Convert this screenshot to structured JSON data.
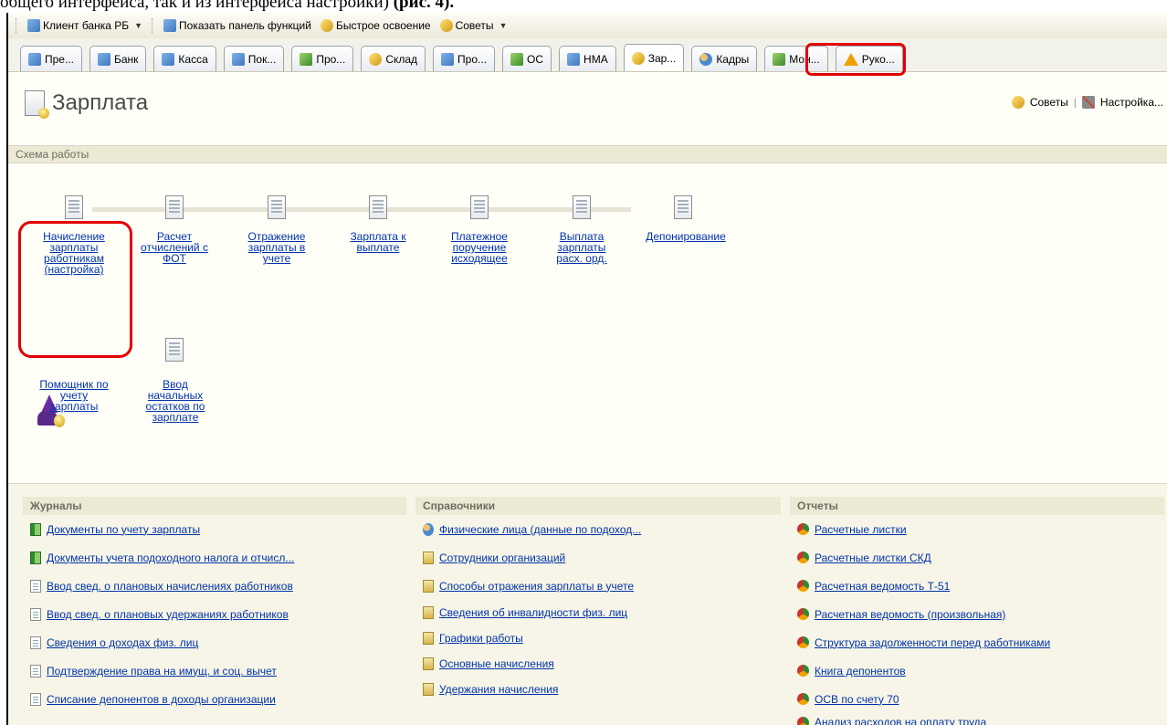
{
  "caption": {
    "text": "общего интерфейса, так и из интерфейса настройки)",
    "bold": "(рис. 4)."
  },
  "toolbar": {
    "items": [
      {
        "label": "Клиент банка РБ",
        "icon": "bank-client-icon",
        "dropdown": true
      },
      {
        "label": "Показать панель функций",
        "icon": "function-panel-icon",
        "dropdown": false
      },
      {
        "label": "Быстрое освоение",
        "icon": "quick-start-icon",
        "dropdown": false
      },
      {
        "label": "Советы",
        "icon": "tips-icon",
        "dropdown": true
      }
    ]
  },
  "tabs": [
    {
      "label": "Пре...",
      "icon": "enterprise-icon",
      "active": false
    },
    {
      "label": "Банк",
      "icon": "bank-icon",
      "active": false
    },
    {
      "label": "Касса",
      "icon": "cash-icon",
      "active": false
    },
    {
      "label": "Пок...",
      "icon": "purchase-icon",
      "active": false
    },
    {
      "label": "Про...",
      "icon": "production-icon",
      "active": false
    },
    {
      "label": "Склад",
      "icon": "warehouse-icon",
      "active": false
    },
    {
      "label": "Про...",
      "icon": "sales-icon",
      "active": false
    },
    {
      "label": "ОС",
      "icon": "fixed-assets-icon",
      "active": false
    },
    {
      "label": "НМА",
      "icon": "intangible-assets-icon",
      "active": false
    },
    {
      "label": "Зар...",
      "icon": "salary-icon",
      "active": true
    },
    {
      "label": "Кадры",
      "icon": "staff-icon",
      "active": false
    },
    {
      "label": "Мон...",
      "icon": "monitor-icon",
      "active": false
    },
    {
      "label": "Руко...",
      "icon": "warning-icon",
      "active": false
    }
  ],
  "page": {
    "title": "Зарплата",
    "tips_label": "Советы",
    "settings_label": "Настройка...",
    "scheme_header": "Схема работы"
  },
  "workflow": [
    {
      "label": "Начисление\nзарплаты\nработникам\n(настройка)"
    },
    {
      "label": "Расчет\nотчислений с\nФОТ"
    },
    {
      "label": "Отражение\nзарплаты в\nучете"
    },
    {
      "label": "Зарплата к\nвыплате"
    },
    {
      "label": "Платежное\nпоручение\nисходящее"
    },
    {
      "label": "Выплата\nзарплаты\nрасх. орд."
    },
    {
      "label": "Депонирование"
    }
  ],
  "extras": [
    {
      "label": "Помощник по\nучету\nзарплаты"
    },
    {
      "label": "Ввод\nначальных\nостатков по\nзарплате"
    }
  ],
  "journals": {
    "header": "Журналы",
    "items": [
      {
        "label": "Документы по учету зарплаты",
        "icon": "journal-green-icon"
      },
      {
        "label": "Документы учета подоходного налога и отчисл...",
        "icon": "journal-green-icon"
      },
      {
        "label": "Ввод свед. о плановых начислениях работников",
        "icon": "document-icon"
      },
      {
        "label": "Ввод свед. о плановых удержаниях работников",
        "icon": "document-icon"
      },
      {
        "label": "Сведения о доходах физ. лиц",
        "icon": "document-icon"
      },
      {
        "label": "Подтверждение права на имущ. и соц. вычет",
        "icon": "document-icon"
      },
      {
        "label": "Списание депонентов в доходы организации",
        "icon": "document-icon"
      }
    ]
  },
  "catalogs": {
    "header": "Справочники",
    "items": [
      {
        "label": "Физические лица (данные по подоход...",
        "icon": "people-icon"
      },
      {
        "label": "Сотрудники организаций",
        "icon": "catalog-icon"
      },
      {
        "label": "Способы отражения зарплаты в учете",
        "icon": "catalog-icon"
      },
      {
        "label": "Сведения об инвалидности физ. лиц",
        "icon": "catalog-icon"
      },
      {
        "label": "Графики работы",
        "icon": "catalog-icon"
      },
      {
        "label": "Основные начисления",
        "icon": "catalog-icon"
      },
      {
        "label": "Удержания начисления",
        "icon": "catalog-icon"
      }
    ]
  },
  "reports": {
    "header": "Отчеты",
    "items": [
      {
        "label": "Расчетные листки",
        "icon": "report-icon"
      },
      {
        "label": "Расчетные листки СКД",
        "icon": "report-icon"
      },
      {
        "label": "Расчетная ведомость Т-51",
        "icon": "report-icon"
      },
      {
        "label": "Расчетная ведомость (произвольная)",
        "icon": "report-icon"
      },
      {
        "label": "Структура задолженности перед работниками",
        "icon": "report-icon"
      },
      {
        "label": "Книга депонентов",
        "icon": "report-icon"
      },
      {
        "label": "ОСВ по счету 70",
        "icon": "report-icon"
      },
      {
        "label": "Анализ расходов на оплату труда",
        "icon": "report-icon"
      }
    ]
  },
  "colors": {
    "link": "#0033aa",
    "highlight": "#e30000",
    "panel_bg": "#f7f5e7"
  }
}
